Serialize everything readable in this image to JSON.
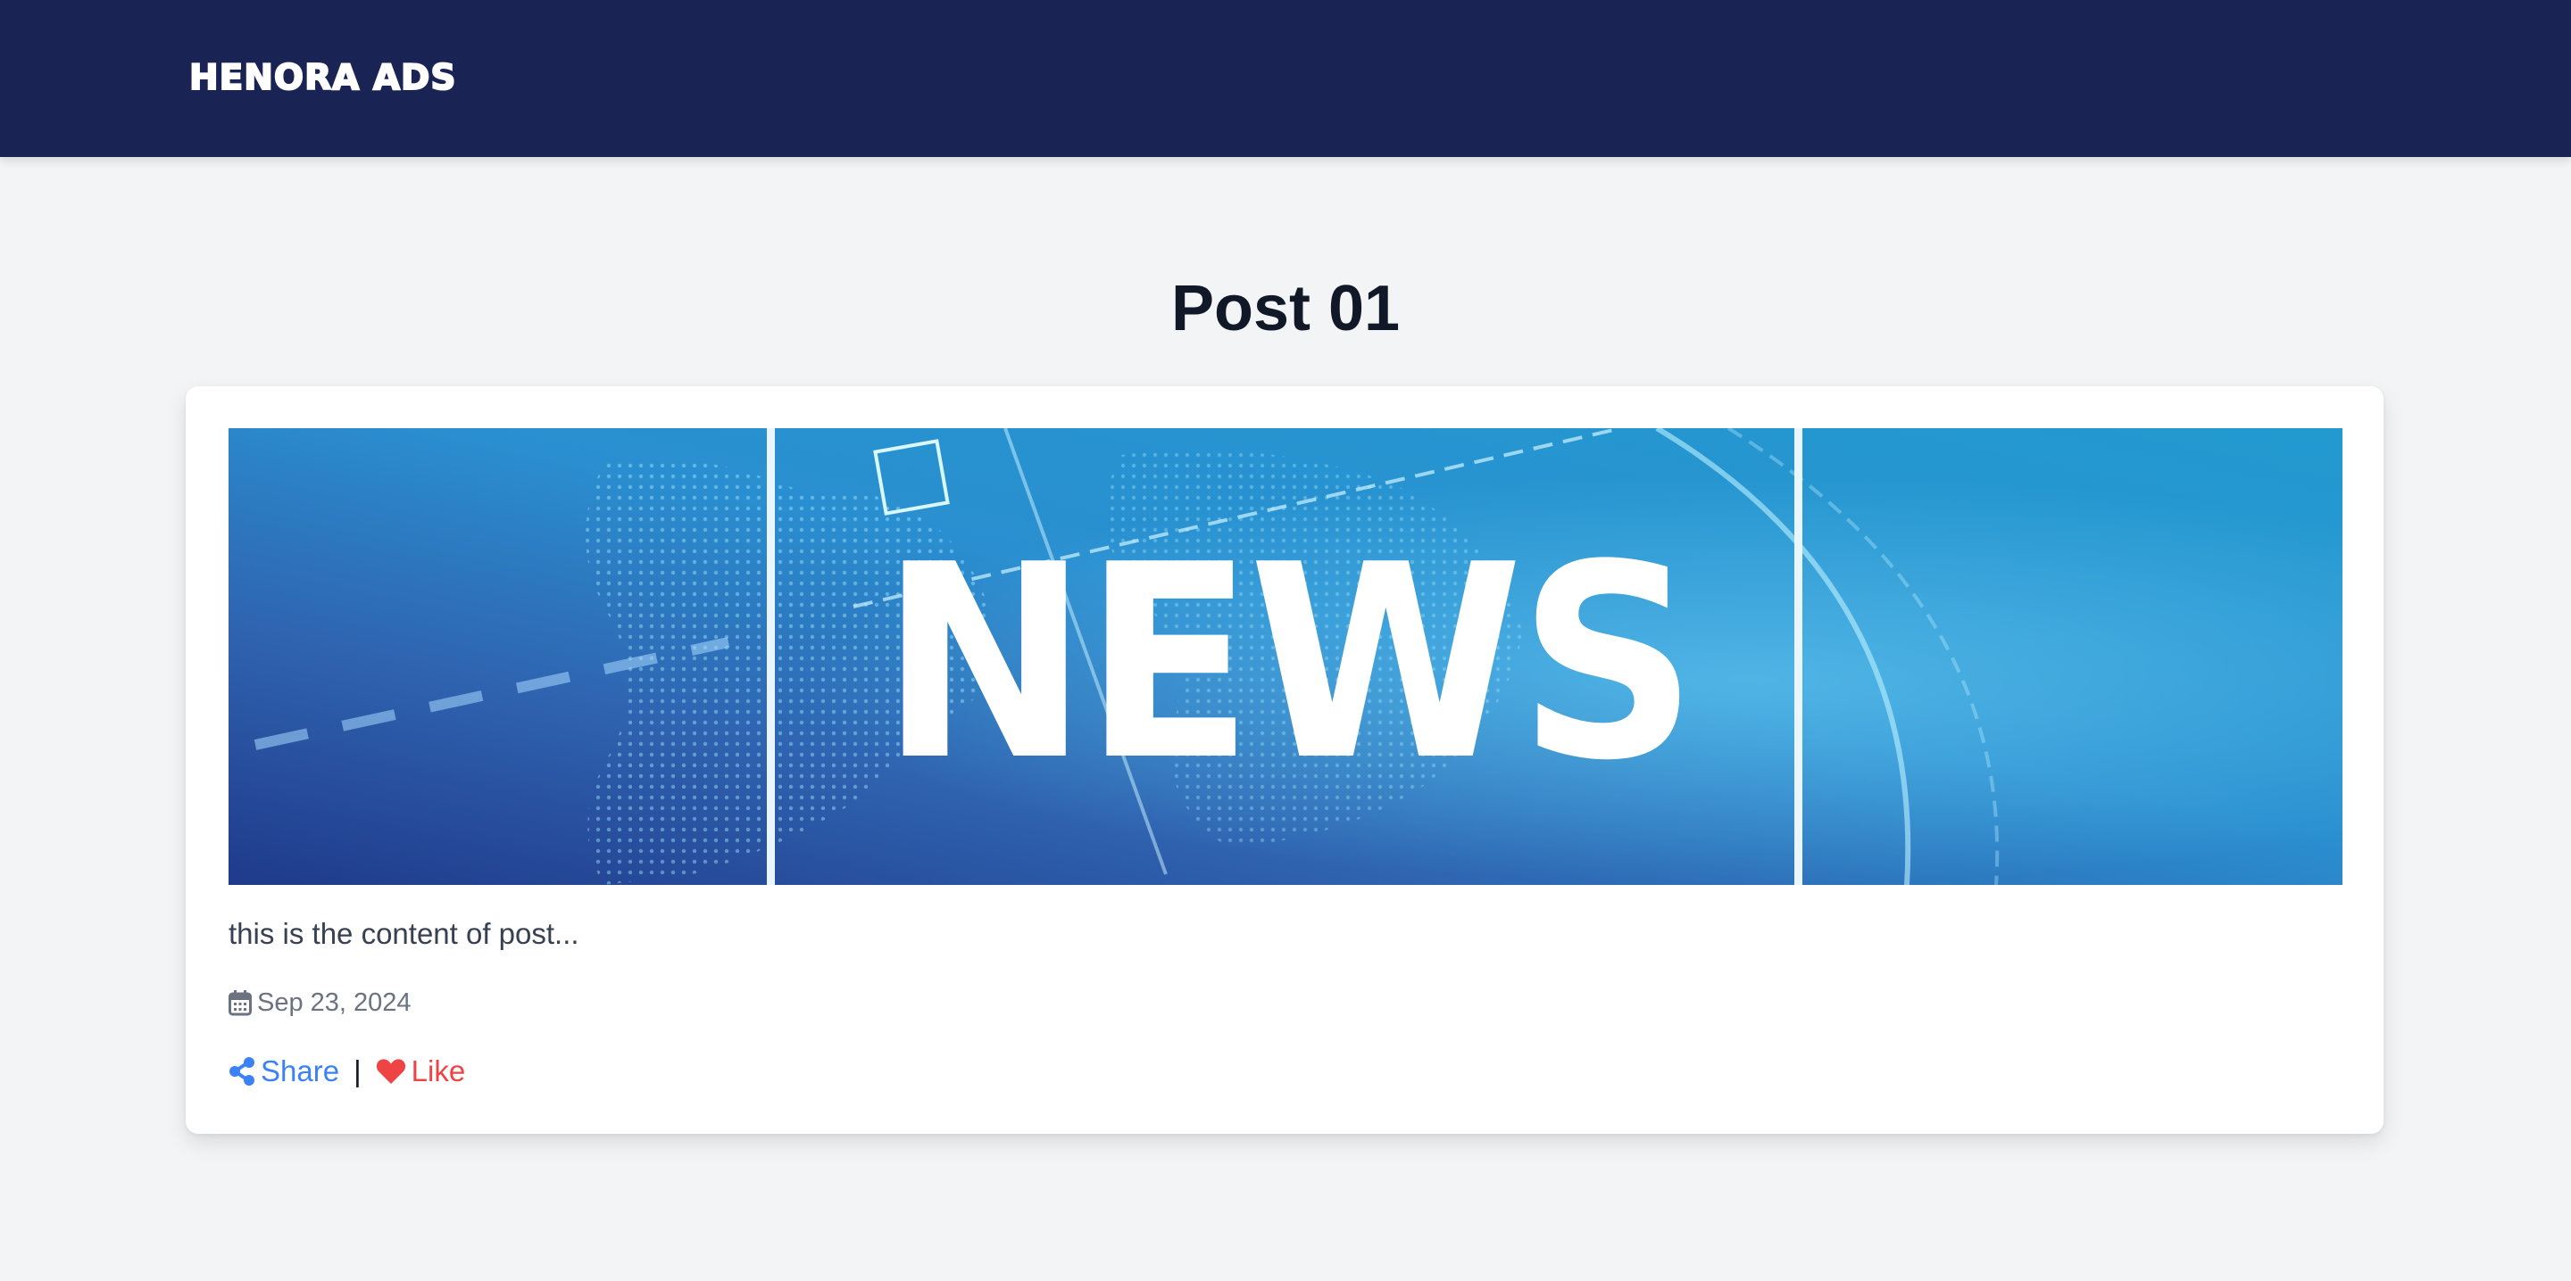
{
  "header": {
    "brand": "HENORA ADS"
  },
  "page": {
    "title": "Post 01"
  },
  "post": {
    "image_text": "NEWS",
    "content": "this is the content of post...",
    "date": "Sep 23, 2024",
    "share_label": "Share",
    "separator": "|",
    "like_label": "Like",
    "icons": {
      "date": "calendar-icon",
      "share": "share-icon",
      "like": "heart-icon"
    }
  },
  "colors": {
    "navbar": "#192454",
    "background": "#f3f4f6",
    "share": "#3b82f6",
    "like": "#ef4444",
    "title": "#111827"
  }
}
